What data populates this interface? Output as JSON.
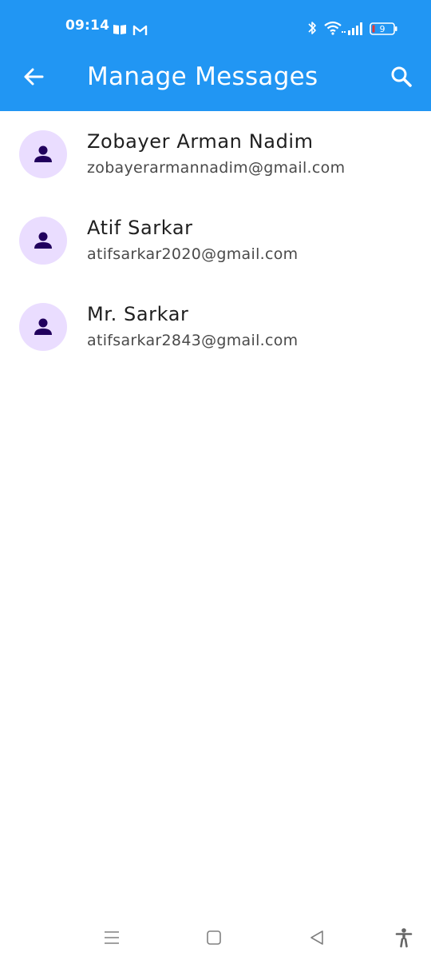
{
  "status_bar": {
    "time": "09:14",
    "battery_level": "9",
    "icons": [
      "book-icon",
      "gmail-icon",
      "bluetooth-icon",
      "wifi-icon",
      "signal-icon",
      "battery-icon"
    ]
  },
  "app_bar": {
    "title": "Manage Messages",
    "back_icon": "arrow-left-icon",
    "search_icon": "search-icon",
    "background_color": "#2196f3"
  },
  "contacts": [
    {
      "name": "Zobayer Arman Nadim",
      "email": "zobayerarmannadim@gmail.com"
    },
    {
      "name": "Atif Sarkar",
      "email": "atifsarkar2020@gmail.com"
    },
    {
      "name": "Mr. Sarkar",
      "email": "atifsarkar2843@gmail.com"
    }
  ],
  "avatar": {
    "icon": "person-icon",
    "background_color": "#eaddff",
    "icon_color": "#21005d"
  },
  "nav_bar": {
    "icons": [
      "menu-icon",
      "home-icon",
      "back-triangle-icon",
      "accessibility-icon"
    ]
  }
}
